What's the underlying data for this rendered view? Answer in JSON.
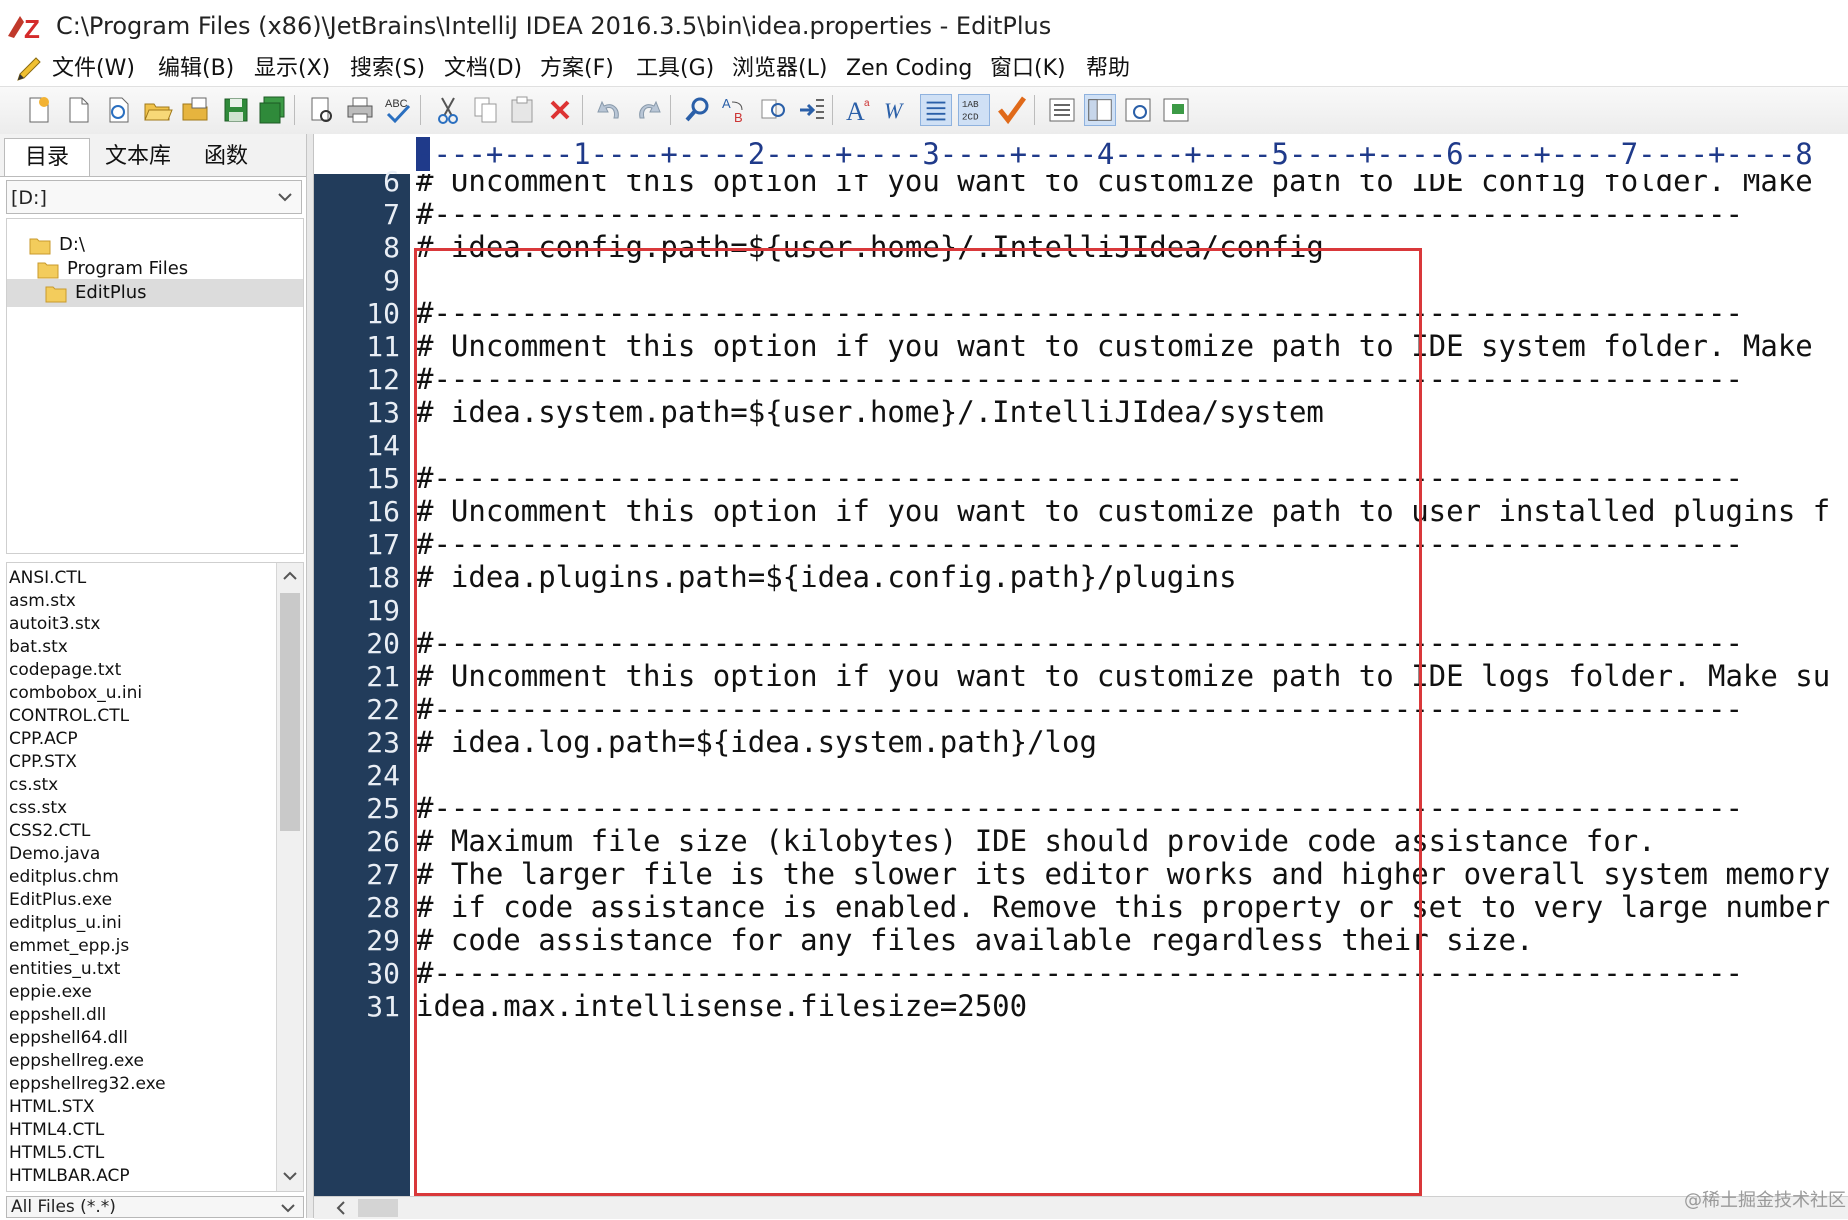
{
  "window": {
    "title": "C:\\Program Files (x86)\\JetBrains\\IntelliJ IDEA 2016.3.5\\bin\\idea.properties - EditPlus"
  },
  "menu": [
    "文件(W)",
    "编辑(B)",
    "显示(X)",
    "搜索(S)",
    "文档(D)",
    "方案(F)",
    "工具(G)",
    "浏览器(L)",
    "Zen Coding",
    "窗口(K)",
    "帮助"
  ],
  "left_panel": {
    "tabs": [
      "目录",
      "文本库",
      "函数"
    ],
    "drive": "[D:]",
    "tree": [
      "D:\\",
      "Program Files",
      "EditPlus"
    ],
    "files": [
      "ANSI.CTL",
      "asm.stx",
      "autoit3.stx",
      "bat.stx",
      "codepage.txt",
      "combobox_u.ini",
      "CONTROL.CTL",
      "CPP.ACP",
      "CPP.STX",
      "cs.stx",
      "css.stx",
      "CSS2.CTL",
      "Demo.java",
      "editplus.chm",
      "EditPlus.exe",
      "editplus_u.ini",
      "emmet_epp.js",
      "entities_u.txt",
      "eppie.exe",
      "eppshell.dll",
      "eppshell64.dll",
      "eppshellreg.exe",
      "eppshellreg32.exe",
      "HTML.STX",
      "HTML4.CTL",
      "HTML5.CTL",
      "HTMLBAR.ACP"
    ],
    "filter": "All Files (*.*)"
  },
  "ruler": "----+----1----+----2----+----3----+----4----+----5----+----6----+----7----+----8",
  "editor": {
    "line_numbers": [
      "6",
      "7",
      "8",
      "9",
      "10",
      "11",
      "12",
      "13",
      "14",
      "15",
      "16",
      "17",
      "18",
      "19",
      "20",
      "21",
      "22",
      "23",
      "24",
      "25",
      "26",
      "27",
      "28",
      "29",
      "30",
      "31"
    ],
    "lines": [
      "# Uncomment this option if you want to customize path to IDE config folder. Make",
      "#---------------------------------------------------------------------------",
      "# idea.config.path=${user.home}/.IntelliJIdea/config",
      "",
      "#---------------------------------------------------------------------------",
      "# Uncomment this option if you want to customize path to IDE system folder. Make",
      "#---------------------------------------------------------------------------",
      "# idea.system.path=${user.home}/.IntelliJIdea/system",
      "",
      "#---------------------------------------------------------------------------",
      "# Uncomment this option if you want to customize path to user installed plugins f",
      "#---------------------------------------------------------------------------",
      "# idea.plugins.path=${idea.config.path}/plugins",
      "",
      "#---------------------------------------------------------------------------",
      "# Uncomment this option if you want to customize path to IDE logs folder. Make su",
      "#---------------------------------------------------------------------------",
      "# idea.log.path=${idea.system.path}/log",
      "",
      "#---------------------------------------------------------------------------",
      "# Maximum file size (kilobytes) IDE should provide code assistance for.",
      "# The larger file is the slower its editor works and higher overall system memory",
      "# if code assistance is enabled. Remove this property or set to very large number",
      "# code assistance for any files available regardless their size.",
      "#---------------------------------------------------------------------------",
      "idea.max.intellisense.filesize=2500"
    ]
  },
  "watermark": "@稀土掘金技术社区",
  "colors": {
    "gutter_bg": "#223c5b",
    "highlight_border": "#d9383a",
    "ruler_text": "#1f3a8a"
  }
}
